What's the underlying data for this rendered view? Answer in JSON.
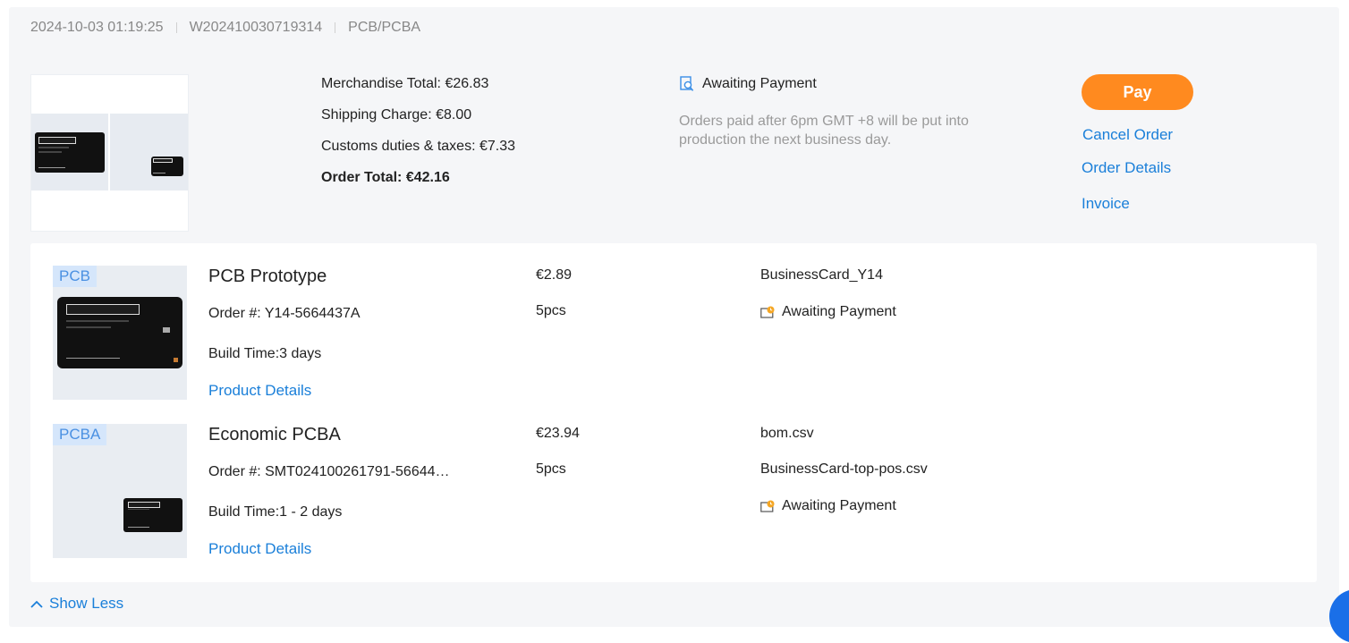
{
  "order": {
    "datetime": "2024-10-03 01:19:25",
    "order_no": "W202410030719314",
    "category": "PCB/PCBA"
  },
  "summary": {
    "merchandise": "Merchandise Total: €26.83",
    "shipping": "Shipping Charge: €8.00",
    "customs": "Customs duties & taxes: €7.33",
    "total": "Order Total: €42.16"
  },
  "status": {
    "label": "Awaiting Payment",
    "note": "Orders paid after 6pm GMT +8 will be put into production the next business day."
  },
  "actions": {
    "pay": "Pay",
    "cancel": "Cancel Order",
    "details": "Order Details",
    "invoice": "Invoice"
  },
  "items": [
    {
      "tag": "PCB",
      "title": "PCB Prototype",
      "order": "Order #: Y14-5664437A",
      "build": "Build Time:3 days",
      "link": "Product Details",
      "price": "€2.89",
      "qty": "5pcs",
      "file": "BusinessCard_Y14",
      "status": "Awaiting Payment"
    },
    {
      "tag": "PCBA",
      "title": "Economic PCBA",
      "order": "Order #: SMT024100261791-56644…",
      "build": "Build Time:1 - 2 days",
      "link": "Product Details",
      "price": "€23.94",
      "qty": "5pcs",
      "file1": "bom.csv",
      "file2": "BusinessCard-top-pos.csv",
      "status": "Awaiting Payment"
    }
  ],
  "footer": {
    "show_less": "Show Less"
  },
  "colors": {
    "accent": "#ff8a1f",
    "link": "#1a7fd9",
    "tag_bg": "#d5e6fb",
    "panel_bg": "#f5f6f8"
  },
  "icons": [
    "search-doc-icon",
    "wallet-clock-icon",
    "chevron-up-icon",
    "chat-icon"
  ]
}
